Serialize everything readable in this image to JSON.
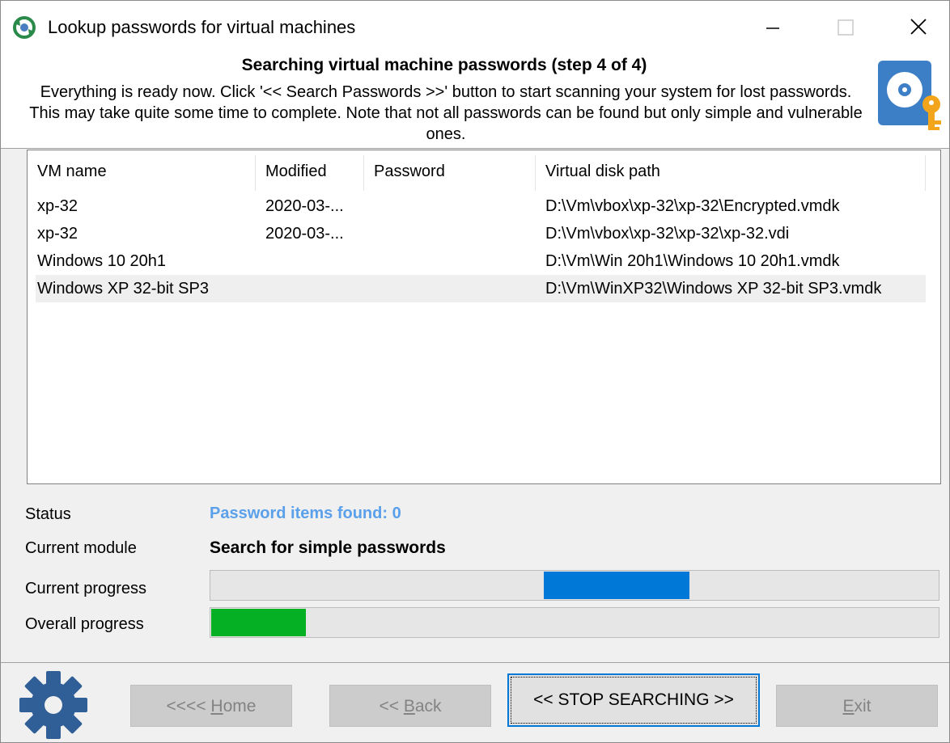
{
  "window": {
    "title": "Lookup passwords for virtual machines",
    "controls": [
      "minimize-icon",
      "maximize-icon",
      "close-icon"
    ]
  },
  "header": {
    "title": "Searching virtual machine passwords (step 4 of 4)",
    "description": "Everything is ready now. Click '<< Search Passwords >>' button to start scanning your system for lost passwords. This may take quite some time to complete. Note that not all passwords can be found but only simple and vulnerable ones."
  },
  "list": {
    "columns": [
      "VM name",
      "Modified",
      "Password",
      "Virtual disk path"
    ],
    "rows": [
      {
        "name": "xp-32",
        "modified": "2020-03-...",
        "password": "",
        "path": "D:\\Vm\\vbox\\xp-32\\xp-32\\Encrypted.vmdk"
      },
      {
        "name": "xp-32",
        "modified": "2020-03-...",
        "password": "",
        "path": "D:\\Vm\\vbox\\xp-32\\xp-32\\xp-32.vdi"
      },
      {
        "name": "Windows 10 20h1",
        "modified": "",
        "password": "",
        "path": "D:\\Vm\\Win 20h1\\Windows 10 20h1.vmdk"
      },
      {
        "name": "Windows XP 32-bit SP3",
        "modified": "",
        "password": "",
        "path": "D:\\Vm\\WinXP32\\Windows XP 32-bit SP3.vmdk"
      }
    ]
  },
  "status": {
    "status_label": "Status",
    "status_value": "Password items found:  0",
    "module_label": "Current module",
    "module_value": "Search for simple passwords",
    "current_progress_label": "Current progress",
    "overall_progress_label": "Overall progress",
    "current_progress_color": "#0078d7",
    "overall_progress_color": "#06b025",
    "overall_progress_fraction": 0.13
  },
  "footer": {
    "home_arrows": "<<<< ",
    "home_hotkey": "H",
    "home_rest": "ome",
    "back_arrows": "<< ",
    "back_hotkey": "B",
    "back_rest": "ack",
    "stop_label": "<<  STOP SEARCHING  >>",
    "exit_hotkey": "E",
    "exit_rest": "xit"
  }
}
